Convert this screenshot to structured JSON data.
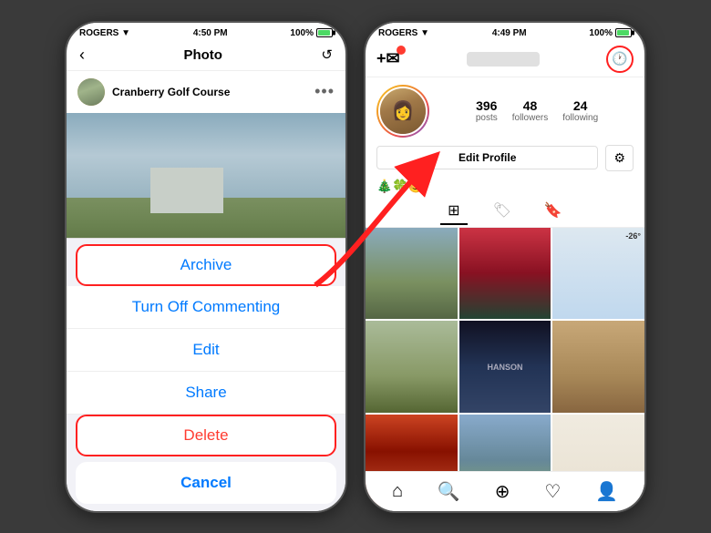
{
  "left_phone": {
    "status_bar": {
      "carrier": "ROGERS ▼",
      "time": "4:50 PM",
      "battery": "100%"
    },
    "header": {
      "back_label": "‹",
      "title": "Photo",
      "refresh_icon": "↺"
    },
    "post": {
      "username": "Cranberry Golf Course",
      "more_icon": "•••"
    },
    "action_sheet": {
      "archive_label": "Archive",
      "turn_off_commenting_label": "Turn Off Commenting",
      "edit_label": "Edit",
      "share_label": "Share",
      "delete_label": "Delete",
      "cancel_label": "Cancel"
    }
  },
  "right_phone": {
    "status_bar": {
      "carrier": "ROGERS ▼",
      "time": "4:49 PM",
      "battery": "100%"
    },
    "header": {
      "plus_label": "+✉",
      "archive_icon": "🕐"
    },
    "profile": {
      "stats": [
        {
          "num": "396",
          "label": "posts"
        },
        {
          "num": "48",
          "label": "followers"
        },
        {
          "num": "24",
          "label": "following"
        }
      ],
      "edit_button": "Edit Profile",
      "settings_icon": "⚙",
      "emojis": "🎄🍀😊"
    },
    "grid_nav": {
      "grid_icon": "⊞",
      "tag_icon": "🏷",
      "bookmark_icon": "🔖"
    },
    "bottom_nav": {
      "home": "⌂",
      "search": "🔍",
      "add": "⊕",
      "heart": "♡",
      "profile": "👤"
    }
  }
}
